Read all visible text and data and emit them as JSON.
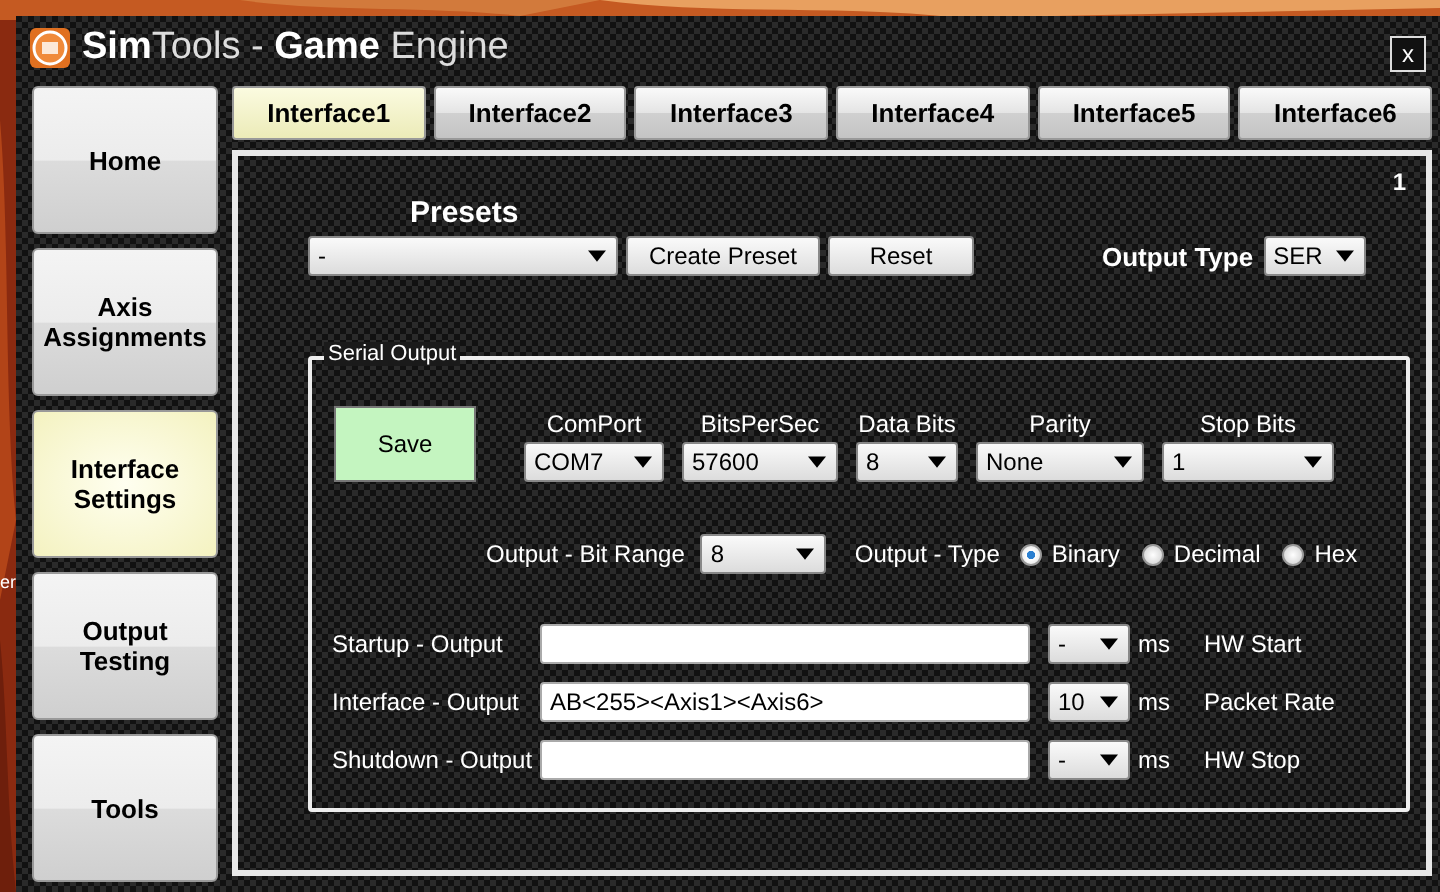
{
  "window": {
    "title": "**Sim**Tools - **Game** Engine",
    "close": "x"
  },
  "desktop_label": "er",
  "sidebar": {
    "items": [
      {
        "label": "Home",
        "selected": false
      },
      {
        "label": "Axis Assignments",
        "selected": false
      },
      {
        "label": "Interface Settings",
        "selected": true
      },
      {
        "label": "Output Testing",
        "selected": false
      },
      {
        "label": "Tools",
        "selected": false
      }
    ]
  },
  "tabs": [
    {
      "label": "Interface1",
      "selected": true
    },
    {
      "label": "Interface2",
      "selected": false
    },
    {
      "label": "Interface3",
      "selected": false
    },
    {
      "label": "Interface4",
      "selected": false
    },
    {
      "label": "Interface5",
      "selected": false
    },
    {
      "label": "Interface6",
      "selected": false
    }
  ],
  "panel_number": "1",
  "presets": {
    "label": "Presets",
    "value": "-",
    "buttons": [
      "Create Preset",
      "Reset"
    ]
  },
  "output_type": {
    "label": "Output Type",
    "value": "SER"
  },
  "serial_output": {
    "title": "Serial Output",
    "save": "Save",
    "fields": [
      {
        "label": "ComPort",
        "value": "COM7"
      },
      {
        "label": "BitsPerSec",
        "value": "57600"
      },
      {
        "label": "Data Bits",
        "value": "8"
      },
      {
        "label": "Parity",
        "value": "None"
      },
      {
        "label": "Stop Bits",
        "value": "1"
      }
    ],
    "bit_range": {
      "label": "Output - Bit Range",
      "value": "8"
    },
    "output_format": {
      "label": "Output - Type",
      "options": [
        {
          "label": "Binary",
          "selected": true
        },
        {
          "label": "Decimal",
          "selected": false
        },
        {
          "label": "Hex",
          "selected": false
        }
      ]
    },
    "rows": [
      {
        "label": "Startup - Output",
        "value": "",
        "rate": "-",
        "unit": "ms",
        "note": "HW Start"
      },
      {
        "label": "Interface - Output",
        "value": "AB<255><Axis1><Axis6>",
        "rate": "10",
        "unit": "ms",
        "note": "Packet Rate"
      },
      {
        "label": "Shutdown - Output",
        "value": "",
        "rate": "-",
        "unit": "ms",
        "note": "HW Stop"
      }
    ]
  }
}
